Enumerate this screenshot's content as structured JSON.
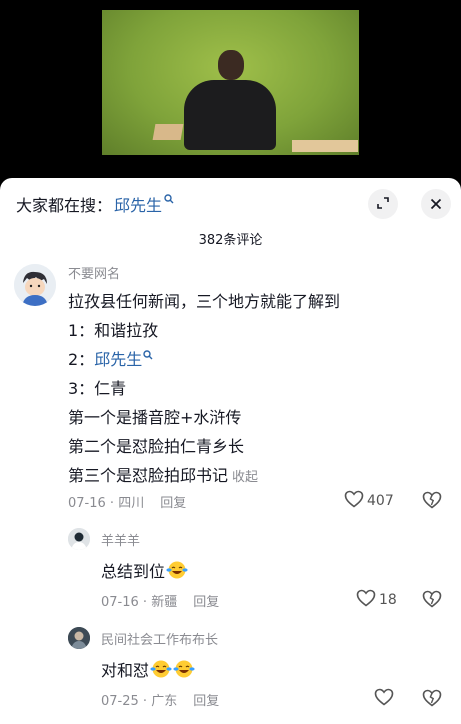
{
  "search": {
    "prefix": "大家都在搜：",
    "keyword": "邱先生"
  },
  "comment_count": "382条评论",
  "comment": {
    "username": "不要网名",
    "lines": [
      "拉孜县任何新闻，三个地方就能了解到",
      "1：和谐拉孜",
      "2：",
      "3：仁青",
      "第一个是播音腔+水浒传",
      "第二个是怼脸拍仁青乡长",
      "第三个是怼脸拍邱书记"
    ],
    "link_text": "邱先生",
    "collapse": "收起",
    "date": "07-16",
    "location": "四川",
    "reply": "回复",
    "likes": "407"
  },
  "replies": [
    {
      "username": "羊羊羊",
      "text": "总结到位",
      "date": "07-16",
      "location": "新疆",
      "reply": "回复",
      "likes": "18"
    },
    {
      "username": "民间社会工作布布长",
      "text": "对和怼",
      "date": "07-25",
      "location": "广东",
      "reply": "回复",
      "likes": ""
    }
  ],
  "icons": {
    "search": "search-icon",
    "expand": "expand-icon",
    "close": "close-icon",
    "like": "heart-icon",
    "dislike": "broken-heart-icon",
    "emoji": "laugh-cry-emoji-icon"
  },
  "colors": {
    "link": "#2a64a8",
    "meta": "#8a8b91",
    "text": "#161823"
  }
}
